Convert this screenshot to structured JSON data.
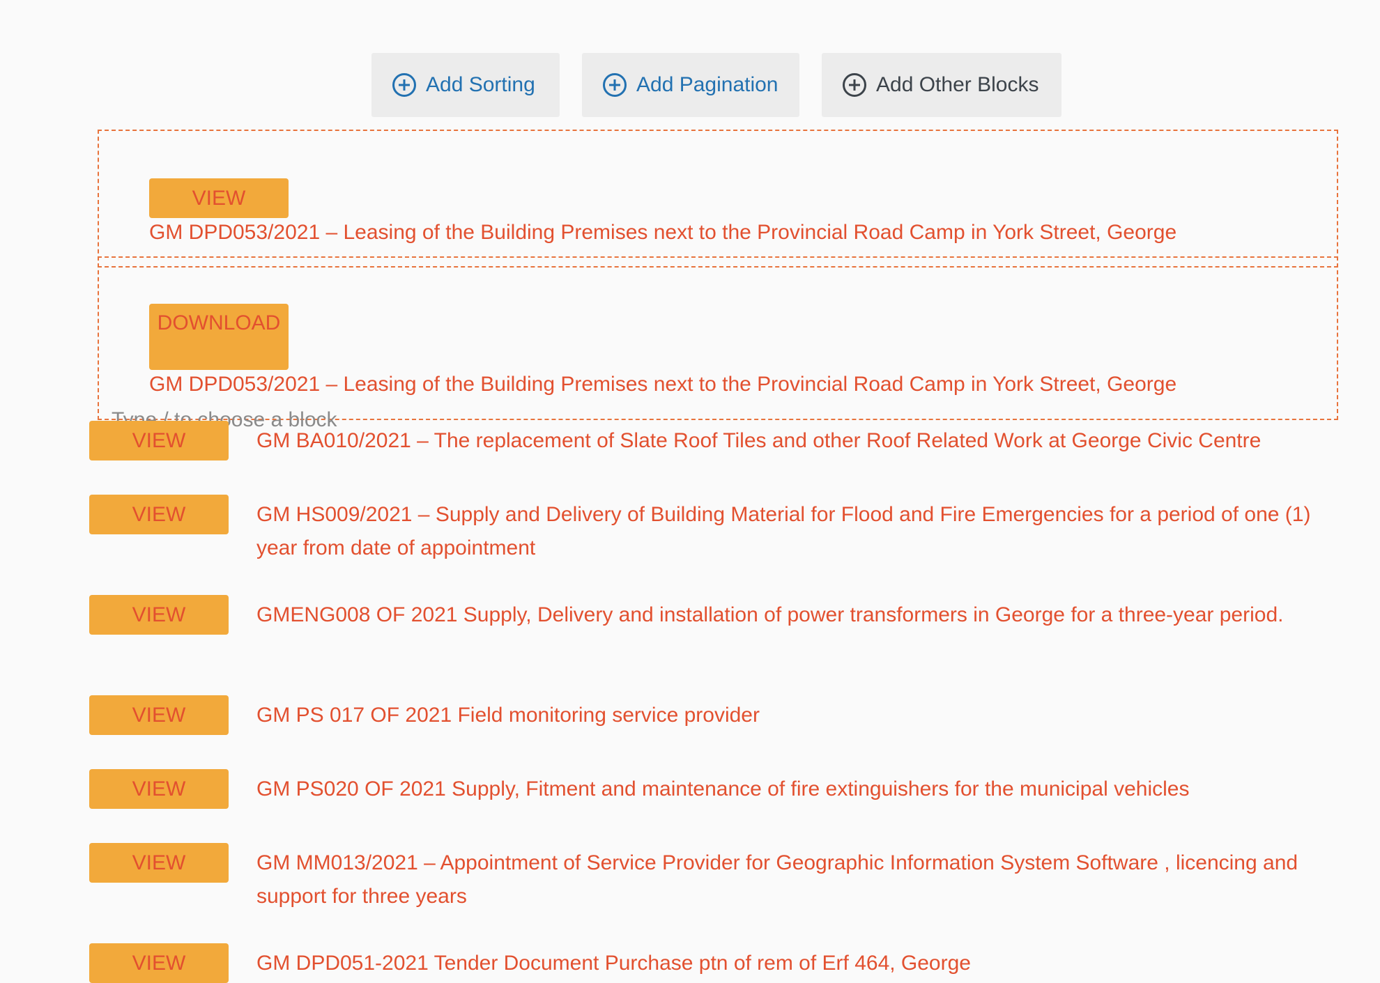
{
  "toolbar": {
    "add_sorting": "Add Sorting",
    "add_pagination": "Add Pagination",
    "add_other_blocks": "Add Other Blocks"
  },
  "selected_blocks": [
    {
      "button": "VIEW",
      "text": "GM DPD053/2021 – Leasing of the Building Premises next to the Provincial Road Camp in York Street, George"
    },
    {
      "button": "DOWNLOAD",
      "text": "GM DPD053/2021 – Leasing of the Building Premises next to the Provincial Road Camp in York Street, George"
    }
  ],
  "hint": "Type / to choose a block",
  "rows": [
    {
      "button": "VIEW",
      "text": "GM BA010/2021 – The replacement of Slate Roof Tiles and other Roof Related Work at George Civic Centre"
    },
    {
      "button": "VIEW",
      "text": "GM HS009/2021 – Supply and Delivery of Building Material for Flood and Fire Emergencies for a period of one (1) year from date of appointment"
    },
    {
      "button": "VIEW",
      "text": "GMENG008 OF 2021 Supply, Delivery and installation of power transformers in George for a three-year period."
    },
    {
      "button": "VIEW",
      "text": "GM PS 017 OF 2021 Field monitoring service provider"
    },
    {
      "button": "VIEW",
      "text": "GM PS020 OF 2021 Supply, Fitment and maintenance of fire extinguishers for the municipal vehicles"
    },
    {
      "button": "VIEW",
      "text": "GM MM013/2021 – Appointment of Service Provider for Geographic Information System Software , licencing and support for three years"
    },
    {
      "button": "VIEW",
      "text": "GM DPD051-2021 Tender Document Purchase ptn of rem of Erf 464, George"
    }
  ],
  "colors": {
    "accent_text": "#e2502f",
    "button_bg": "#f2a93b",
    "toolbar_link": "#2271b1",
    "selection_border": "#e8733c"
  }
}
